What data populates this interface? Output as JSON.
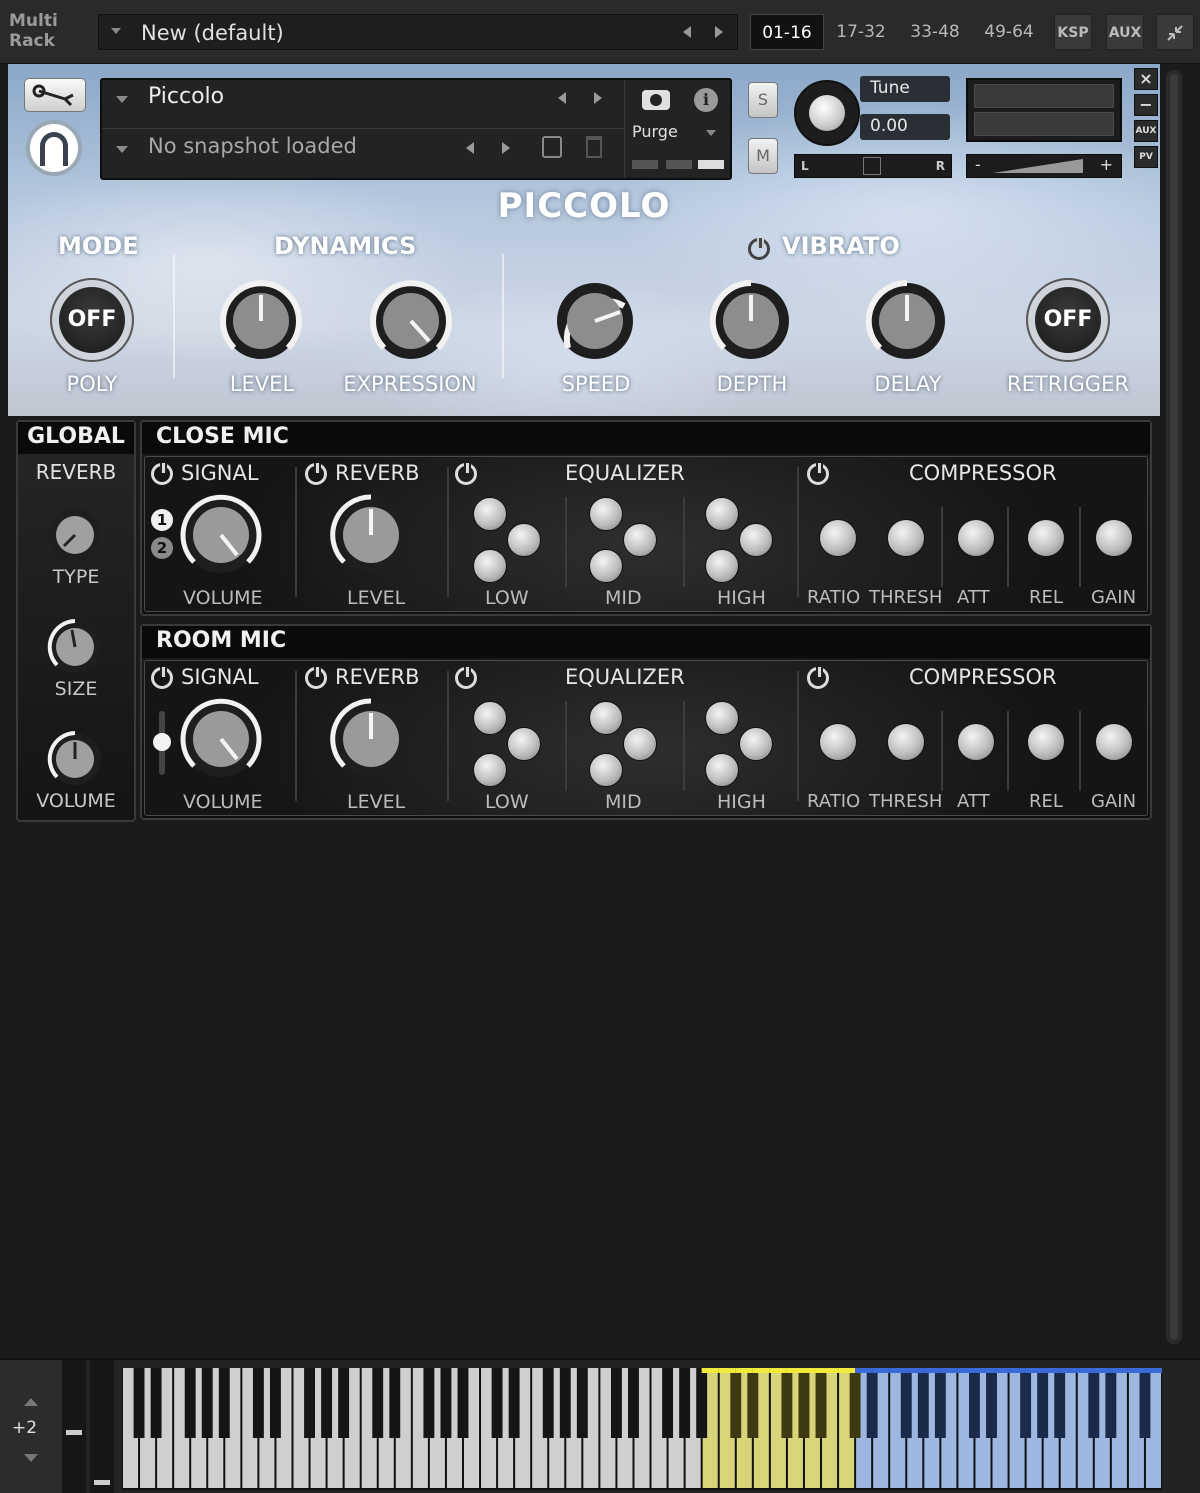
{
  "rack": {
    "title_line1": "Multi",
    "title_line2": "Rack",
    "preset": "New (default)",
    "bank_tabs": [
      "01-16",
      "17-32",
      "33-48",
      "49-64"
    ],
    "ksp_label": "KSP",
    "aux_label": "AUX"
  },
  "header": {
    "instrument": "Piccolo",
    "snapshot": "No snapshot loaded",
    "purge_label": "Purge",
    "solo_label": "S",
    "mute_label": "M",
    "tune_label": "Tune",
    "tune_value": "0.00",
    "pan_left": "L",
    "pan_right": "R",
    "vol_minus": "-",
    "vol_plus": "+",
    "aux_btn": "AUX",
    "pv_btn": "PV",
    "close_btn": "×",
    "min_btn": "−"
  },
  "instrument": {
    "title": "PICCOLO",
    "mode": {
      "title": "MODE",
      "button": "OFF",
      "label": "POLY"
    },
    "dynamics": {
      "title": "DYNAMICS",
      "level_label": "LEVEL",
      "expression_label": "EXPRESSION"
    },
    "vibrato": {
      "title": "VIBRATO",
      "speed_label": "SPEED",
      "depth_label": "DEPTH",
      "delay_label": "DELAY",
      "retrigger_button": "OFF",
      "retrigger_label": "RETRIGGER"
    }
  },
  "global": {
    "title": "GLOBAL",
    "reverb_label": "REVERB",
    "type_label": "TYPE",
    "size_label": "SIZE",
    "volume_label": "VOLUME"
  },
  "close_mic": {
    "title": "CLOSE MIC",
    "signal": "SIGNAL",
    "reverb": "REVERB",
    "equalizer": "EQUALIZER",
    "compressor": "COMPRESSOR",
    "volume": "VOLUME",
    "level": "LEVEL",
    "low": "LOW",
    "mid": "MID",
    "high": "HIGH",
    "ratio": "RATIO",
    "thresh": "THRESH",
    "att": "ATT",
    "rel": "REL",
    "gain": "GAIN",
    "badge1": "1",
    "badge2": "2"
  },
  "room_mic": {
    "title": "ROOM MIC",
    "signal": "SIGNAL",
    "reverb": "REVERB",
    "equalizer": "EQUALIZER",
    "compressor": "COMPRESSOR",
    "volume": "VOLUME",
    "level": "LEVEL",
    "low": "LOW",
    "mid": "MID",
    "high": "HIGH",
    "ratio": "RATIO",
    "thresh": "THRESH",
    "att": "ATT",
    "rel": "REL",
    "gain": "GAIN"
  },
  "keyboard": {
    "octave": "+2",
    "white_key_count": 61,
    "yellow_range": [
      34,
      42
    ],
    "blue_range": [
      43,
      60
    ],
    "colors": {
      "white": "#cfcfcf",
      "yellow": "#d8d47a",
      "blue": "#9db7e0"
    }
  }
}
